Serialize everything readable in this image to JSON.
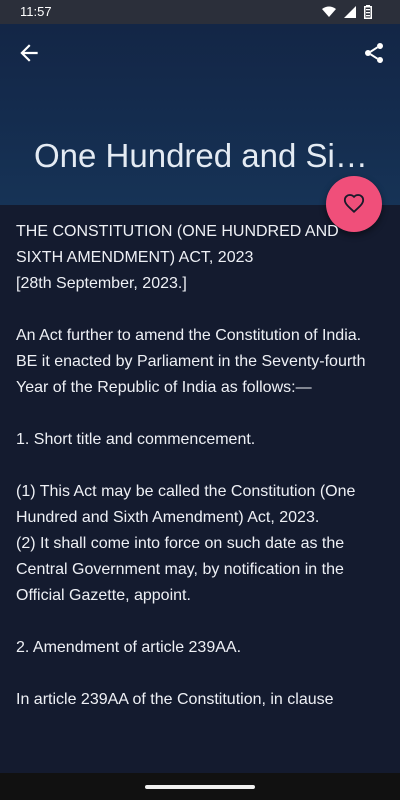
{
  "status": {
    "time": "11:57"
  },
  "appbar": {
    "title": "One Hundred and Si…",
    "back_icon": "arrow-back-icon",
    "share_icon": "share-icon",
    "favorite_icon": "heart-outline-icon"
  },
  "document": {
    "heading": "THE CONSTITUTION (ONE HUNDRED AND SIXTH AMENDMENT) ACT, 2023",
    "date": "[28th September, 2023.]",
    "intro": "An Act further to amend the Constitution of India.",
    "enact": "BE it enacted by Parliament in the Seventy-fourth Year of the Republic of India as follows:—",
    "section1_title": "1. Short title and commencement.",
    "section1_p1": "(1) This Act may be called the Constitution (One Hundred and Sixth Amendment) Act, 2023.",
    "section1_p2": "(2) It shall come into force on such date as the Central Government may, by notification in the Official Gazette, appoint.",
    "section2_title": "2. Amendment of article 239AA.",
    "section2_text": "In article 239AA of the Constitution, in clause"
  },
  "colors": {
    "accent": "#f04f7a",
    "background": "#141b2f",
    "appbar": "#163356"
  }
}
